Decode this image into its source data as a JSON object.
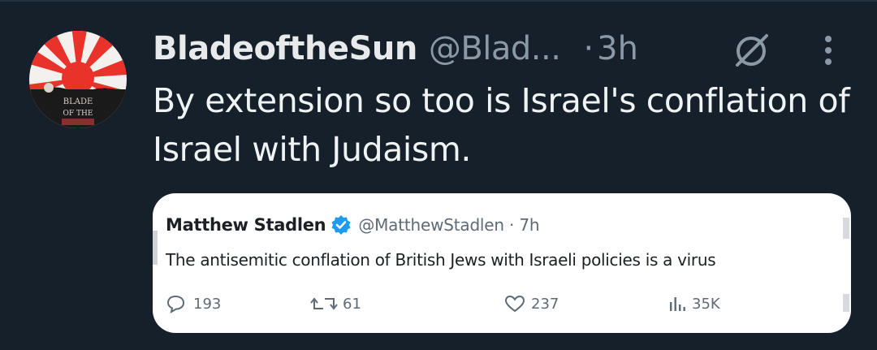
{
  "tweet": {
    "display_name": "BladeoftheSun",
    "handle": "@Blad...",
    "separator": "·",
    "time": "3h",
    "text": "By extension so too is Israel's conflation of Israel with Judaism.",
    "avatar_text_line1": "BLADE",
    "avatar_text_line2": "OF THE"
  },
  "quote": {
    "name": "Matthew Stadlen",
    "handle_time": "@MatthewStadlen · 7h",
    "text": "The antisemitic conflation of British Jews with Israeli policies is a virus",
    "replies": "193",
    "retweets": "61",
    "likes": "237",
    "views": "35K"
  },
  "icons": {
    "grok": "slashed-circle-icon",
    "more": "vertical-ellipsis-icon",
    "verified": "verified-badge-icon",
    "reply": "reply-bubble-icon",
    "retweet": "retweet-icon",
    "like": "heart-icon",
    "views": "views-bar-chart-icon"
  },
  "colors": {
    "background": "#16202b",
    "primary_text": "#e7e9ea",
    "secondary_text": "#8b98a5",
    "verified_blue": "#1d9bf0",
    "avatar_red": "#e8322a"
  }
}
